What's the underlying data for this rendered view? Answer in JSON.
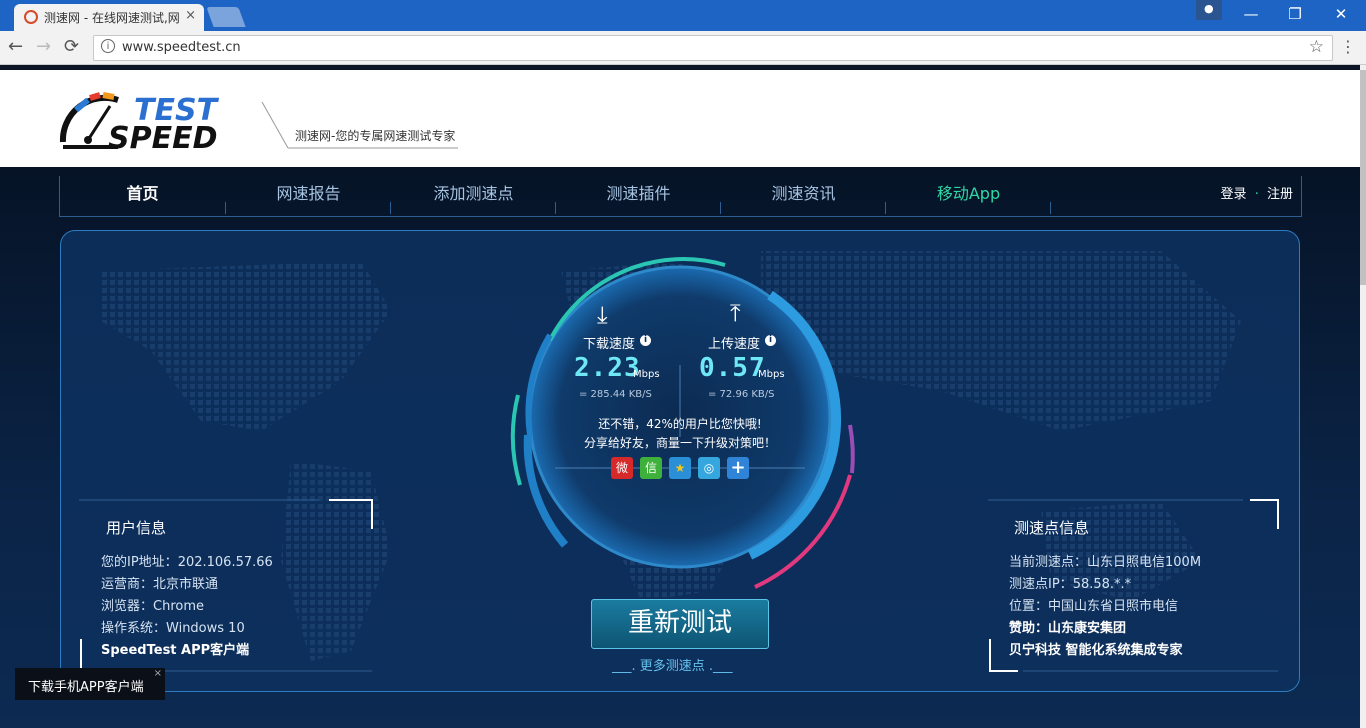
{
  "browser": {
    "tab_title": "测速网 - 在线网速测试,网",
    "tab_close": "×",
    "url": "www.speedtest.cn",
    "info_icon": "i",
    "star_icon": "☆",
    "back_icon": "←",
    "forward_icon": "→",
    "reload_icon": "⟳",
    "menu_icon": "⋮",
    "minimize_icon": "—",
    "maximize_icon": "❐",
    "close_icon": "✕",
    "profile_icon": "●"
  },
  "header": {
    "logo_top": "TEST",
    "logo_bottom": "SPEED",
    "slogan": "测速网-您的专属网速测试专家"
  },
  "nav": {
    "items": [
      "首页",
      "网速报告",
      "添加测速点",
      "测速插件",
      "测速资讯",
      "移动App"
    ],
    "login": "登录",
    "dot": "·",
    "register": "注册"
  },
  "user_info": {
    "title": "用户信息",
    "ip_label": "您的IP地址：",
    "ip": "202.106.57.66",
    "isp_label": "运营商：",
    "isp": "北京市联通",
    "browser_label": "浏览器：",
    "browser": "Chrome",
    "os_label": "操作系统：",
    "os": "Windows 10",
    "app": "SpeedTest APP客户端"
  },
  "speed": {
    "download_label": "下载速度",
    "download_value": "2.23",
    "download_unit": "Mbps",
    "download_sub": "= 285.44  KB/S",
    "upload_label": "上传速度",
    "upload_value": "0.57",
    "upload_unit": "Mbps",
    "upload_sub": "= 72.96  KB/S",
    "tip1": "还不错，42%的用户比您快哦!",
    "tip2": "分享给好友，商量一下升级对策吧！",
    "info_glyph": "i",
    "download_arrow": "⤓",
    "upload_arrow": "⤒"
  },
  "share": {
    "weibo": "微",
    "wechat": "信",
    "qzone": "★",
    "tencent": "◎",
    "more": "+"
  },
  "actions": {
    "retest": "重新测试",
    "more": "___. 更多测速点 .___"
  },
  "server_info": {
    "title": "测速点信息",
    "current_label": "当前测速点：",
    "current": "山东日照电信100M",
    "ip_label": "测速点IP：",
    "ip": "58.58.*.*",
    "location_label": "位置：",
    "location": "中国山东省日照市电信",
    "sponsor_label": "赞助：",
    "sponsor": "山东康安集团",
    "ad": "贝宁科技 智能化系统集成专家"
  },
  "download_bar": {
    "label": "下载手机APP客户端",
    "close": "×"
  },
  "colors": {
    "titlebar": "#1d64c4",
    "accent_cyan": "#6ee8f5",
    "accent_green": "#2ed8a6",
    "accent_pink": "#e2397e",
    "panel_border": "#2d7bc0"
  }
}
